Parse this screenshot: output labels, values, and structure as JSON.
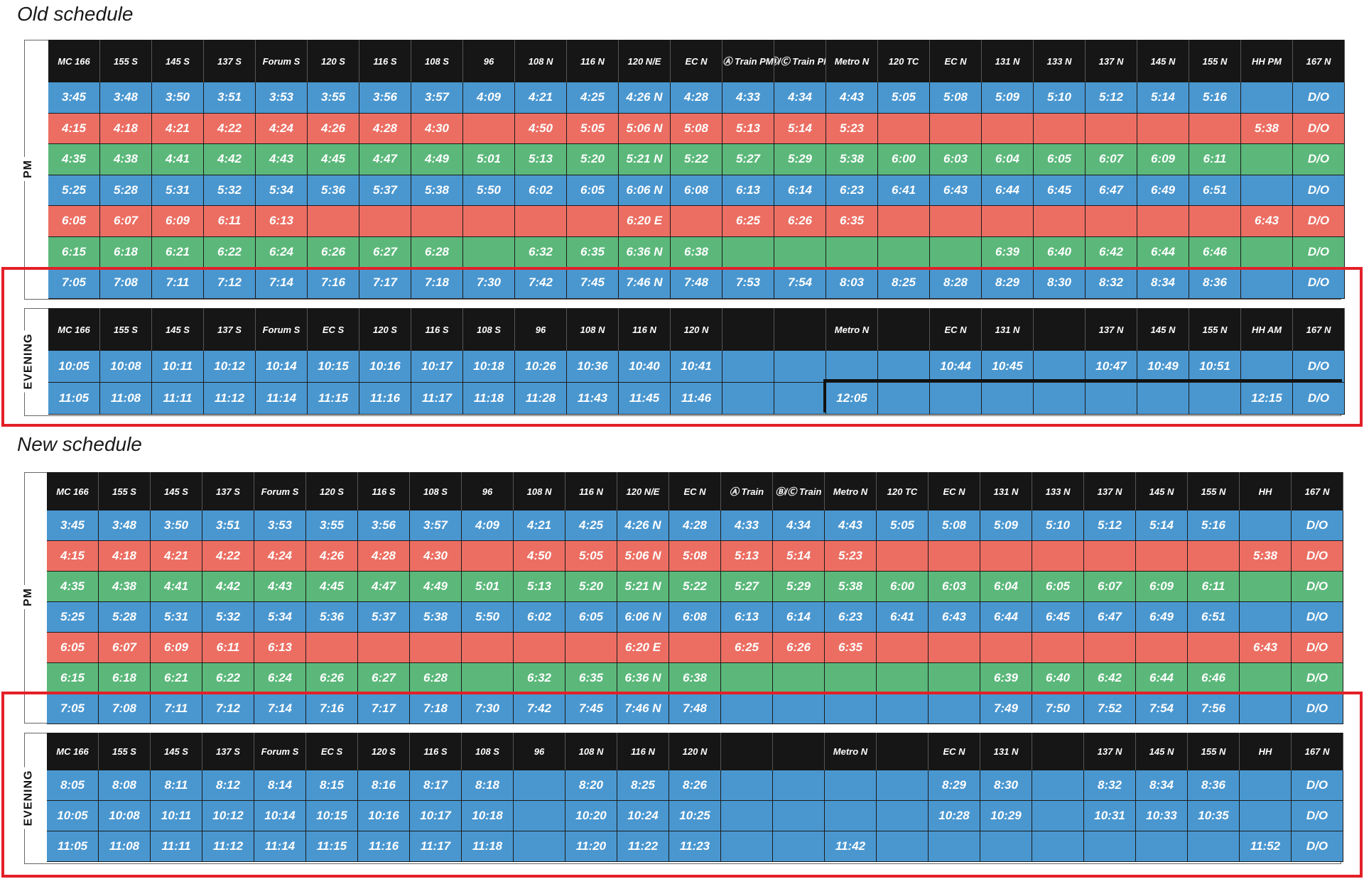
{
  "colors": {
    "blue": "#4a97d0",
    "red": "#ec6e62",
    "green": "#5bb87a",
    "header": "#161616",
    "highlight": "#e32028"
  },
  "old_schedule": {
    "title": "Old schedule",
    "pm": {
      "label": "PM",
      "header": [
        "MC 166",
        "155 S",
        "145 S",
        "137 S",
        "Forum S",
        "120 S",
        "116 S",
        "108 S",
        "96",
        "108 N",
        "116 N",
        "120 N/E",
        "EC N",
        "Ⓐ Train PM",
        "Ⓑ/Ⓒ Train PM",
        "Metro N",
        "120 TC",
        "EC N",
        "131 N",
        "133 N",
        "137 N",
        "145 N",
        "155 N",
        "HH PM",
        "167 N"
      ],
      "rows": [
        {
          "color": "blue",
          "cells": [
            "3:45",
            "3:48",
            "3:50",
            "3:51",
            "3:53",
            "3:55",
            "3:56",
            "3:57",
            "4:09",
            "4:21",
            "4:25",
            "4:26 N",
            "4:28",
            "4:33",
            "4:34",
            "4:43",
            "5:05",
            "5:08",
            "5:09",
            "5:10",
            "5:12",
            "5:14",
            "5:16",
            "",
            "D/O"
          ]
        },
        {
          "color": "red",
          "cells": [
            "4:15",
            "4:18",
            "4:21",
            "4:22",
            "4:24",
            "4:26",
            "4:28",
            "4:30",
            "",
            "4:50",
            "5:05",
            "5:06 N",
            "5:08",
            "5:13",
            "5:14",
            "5:23",
            "",
            "",
            "",
            "",
            "",
            "",
            "",
            "5:38",
            "D/O"
          ]
        },
        {
          "color": "green",
          "cells": [
            "4:35",
            "4:38",
            "4:41",
            "4:42",
            "4:43",
            "4:45",
            "4:47",
            "4:49",
            "5:01",
            "5:13",
            "5:20",
            "5:21 N",
            "5:22",
            "5:27",
            "5:29",
            "5:38",
            "6:00",
            "6:03",
            "6:04",
            "6:05",
            "6:07",
            "6:09",
            "6:11",
            "",
            "D/O"
          ]
        },
        {
          "color": "blue",
          "cells": [
            "5:25",
            "5:28",
            "5:31",
            "5:32",
            "5:34",
            "5:36",
            "5:37",
            "5:38",
            "5:50",
            "6:02",
            "6:05",
            "6:06 N",
            "6:08",
            "6:13",
            "6:14",
            "6:23",
            "6:41",
            "6:43",
            "6:44",
            "6:45",
            "6:47",
            "6:49",
            "6:51",
            "",
            "D/O"
          ]
        },
        {
          "color": "red",
          "cells": [
            "6:05",
            "6:07",
            "6:09",
            "6:11",
            "6:13",
            "",
            "",
            "",
            "",
            "",
            "",
            "6:20 E",
            "",
            "6:25",
            "6:26",
            "6:35",
            "",
            "",
            "",
            "",
            "",
            "",
            "",
            "6:43",
            "D/O"
          ]
        },
        {
          "color": "green",
          "cells": [
            "6:15",
            "6:18",
            "6:21",
            "6:22",
            "6:24",
            "6:26",
            "6:27",
            "6:28",
            "",
            "6:32",
            "6:35",
            "6:36 N",
            "6:38",
            "",
            "",
            "",
            "",
            "",
            "6:39",
            "6:40",
            "6:42",
            "6:44",
            "6:46",
            "",
            "D/O"
          ]
        },
        {
          "color": "blue",
          "cells": [
            "7:05",
            "7:08",
            "7:11",
            "7:12",
            "7:14",
            "7:16",
            "7:17",
            "7:18",
            "7:30",
            "7:42",
            "7:45",
            "7:46 N",
            "7:48",
            "7:53",
            "7:54",
            "8:03",
            "8:25",
            "8:28",
            "8:29",
            "8:30",
            "8:32",
            "8:34",
            "8:36",
            "",
            "D/O"
          ]
        }
      ]
    },
    "evening": {
      "label": "EVENING",
      "header": [
        "MC 166",
        "155 S",
        "145 S",
        "137 S",
        "Forum S",
        "EC S",
        "120 S",
        "116 S",
        "108 S",
        "96",
        "108 N",
        "116 N",
        "120 N",
        "",
        "",
        "Metro N",
        "",
        "EC N",
        "131 N",
        "",
        "137 N",
        "145 N",
        "155 N",
        "HH AM",
        "167 N"
      ],
      "rows": [
        {
          "color": "blue",
          "cells": [
            "10:05",
            "10:08",
            "10:11",
            "10:12",
            "10:14",
            "10:15",
            "10:16",
            "10:17",
            "10:18",
            "10:26",
            "10:36",
            "10:40",
            "10:41",
            "",
            "",
            "",
            "",
            "10:44",
            "10:45",
            "",
            "10:47",
            "10:49",
            "10:51",
            "",
            "D/O"
          ]
        },
        {
          "color": "blue",
          "cells": [
            "11:05",
            "11:08",
            "11:11",
            "11:12",
            "11:14",
            "11:15",
            "11:16",
            "11:17",
            "11:18",
            "11:28",
            "11:43",
            "11:45",
            "11:46",
            "",
            "",
            "12:05",
            "",
            "",
            "",
            "",
            "",
            "",
            "",
            "12:15",
            "D/O"
          ]
        }
      ]
    }
  },
  "new_schedule": {
    "title": "New schedule",
    "pm": {
      "label": "PM",
      "header": [
        "MC 166",
        "155 S",
        "145 S",
        "137 S",
        "Forum S",
        "120 S",
        "116 S",
        "108 S",
        "96",
        "108 N",
        "116 N",
        "120 N/E",
        "EC N",
        "Ⓐ Train",
        "Ⓑ/Ⓒ Train",
        "Metro N",
        "120 TC",
        "EC N",
        "131 N",
        "133 N",
        "137 N",
        "145 N",
        "155 N",
        "HH",
        "167 N"
      ],
      "rows": [
        {
          "color": "blue",
          "cells": [
            "3:45",
            "3:48",
            "3:50",
            "3:51",
            "3:53",
            "3:55",
            "3:56",
            "3:57",
            "4:09",
            "4:21",
            "4:25",
            "4:26 N",
            "4:28",
            "4:33",
            "4:34",
            "4:43",
            "5:05",
            "5:08",
            "5:09",
            "5:10",
            "5:12",
            "5:14",
            "5:16",
            "",
            "D/O"
          ]
        },
        {
          "color": "red",
          "cells": [
            "4:15",
            "4:18",
            "4:21",
            "4:22",
            "4:24",
            "4:26",
            "4:28",
            "4:30",
            "",
            "4:50",
            "5:05",
            "5:06 N",
            "5:08",
            "5:13",
            "5:14",
            "5:23",
            "",
            "",
            "",
            "",
            "",
            "",
            "",
            "5:38",
            "D/O"
          ]
        },
        {
          "color": "green",
          "cells": [
            "4:35",
            "4:38",
            "4:41",
            "4:42",
            "4:43",
            "4:45",
            "4:47",
            "4:49",
            "5:01",
            "5:13",
            "5:20",
            "5:21 N",
            "5:22",
            "5:27",
            "5:29",
            "5:38",
            "6:00",
            "6:03",
            "6:04",
            "6:05",
            "6:07",
            "6:09",
            "6:11",
            "",
            "D/O"
          ]
        },
        {
          "color": "blue",
          "cells": [
            "5:25",
            "5:28",
            "5:31",
            "5:32",
            "5:34",
            "5:36",
            "5:37",
            "5:38",
            "5:50",
            "6:02",
            "6:05",
            "6:06 N",
            "6:08",
            "6:13",
            "6:14",
            "6:23",
            "6:41",
            "6:43",
            "6:44",
            "6:45",
            "6:47",
            "6:49",
            "6:51",
            "",
            "D/O"
          ]
        },
        {
          "color": "red",
          "cells": [
            "6:05",
            "6:07",
            "6:09",
            "6:11",
            "6:13",
            "",
            "",
            "",
            "",
            "",
            "",
            "6:20 E",
            "",
            "6:25",
            "6:26",
            "6:35",
            "",
            "",
            "",
            "",
            "",
            "",
            "",
            "6:43",
            "D/O"
          ]
        },
        {
          "color": "green",
          "cells": [
            "6:15",
            "6:18",
            "6:21",
            "6:22",
            "6:24",
            "6:26",
            "6:27",
            "6:28",
            "",
            "6:32",
            "6:35",
            "6:36 N",
            "6:38",
            "",
            "",
            "",
            "",
            "",
            "6:39",
            "6:40",
            "6:42",
            "6:44",
            "6:46",
            "",
            "D/O"
          ]
        },
        {
          "color": "blue",
          "cells": [
            "7:05",
            "7:08",
            "7:11",
            "7:12",
            "7:14",
            "7:16",
            "7:17",
            "7:18",
            "7:30",
            "7:42",
            "7:45",
            "7:46  N",
            "7:48",
            "",
            "",
            "",
            "",
            "",
            "7:49",
            "7:50",
            "7:52",
            "7:54",
            "7:56",
            "",
            "D/O"
          ]
        }
      ]
    },
    "evening": {
      "label": "EVENING",
      "header": [
        "MC 166",
        "155 S",
        "145 S",
        "137 S",
        "Forum S",
        "EC S",
        "120 S",
        "116 S",
        "108 S",
        "96",
        "108 N",
        "116 N",
        "120 N",
        "",
        "",
        "Metro N",
        "",
        "EC N",
        "131 N",
        "",
        "137 N",
        "145 N",
        "155 N",
        "HH",
        "167 N"
      ],
      "rows": [
        {
          "color": "blue",
          "cells": [
            "8:05",
            "8:08",
            "8:11",
            "8:12",
            "8:14",
            "8:15",
            "8:16",
            "8:17",
            "8:18",
            "",
            "8:20",
            "8:25",
            "8:26",
            "",
            "",
            "",
            "",
            "8:29",
            "8:30",
            "",
            "8:32",
            "8:34",
            "8:36",
            "",
            "D/O"
          ]
        },
        {
          "color": "blue",
          "cells": [
            "10:05",
            "10:08",
            "10:11",
            "10:12",
            "10:14",
            "10:15",
            "10:16",
            "10:17",
            "10:18",
            "",
            "10:20",
            "10:24",
            "10:25",
            "",
            "",
            "",
            "",
            "10:28",
            "10:29",
            "",
            "10:31",
            "10:33",
            "10:35",
            "",
            "D/O"
          ]
        },
        {
          "color": "blue",
          "cells": [
            "11:05",
            "11:08",
            "11:11",
            "11:12",
            "11:14",
            "11:15",
            "11:16",
            "11:17",
            "11:18",
            "",
            "11:20",
            "11:22",
            "11:23",
            "",
            "",
            "11:42",
            "",
            "",
            "",
            "",
            "",
            "",
            "",
            "11:52",
            "D/O"
          ]
        }
      ]
    }
  }
}
